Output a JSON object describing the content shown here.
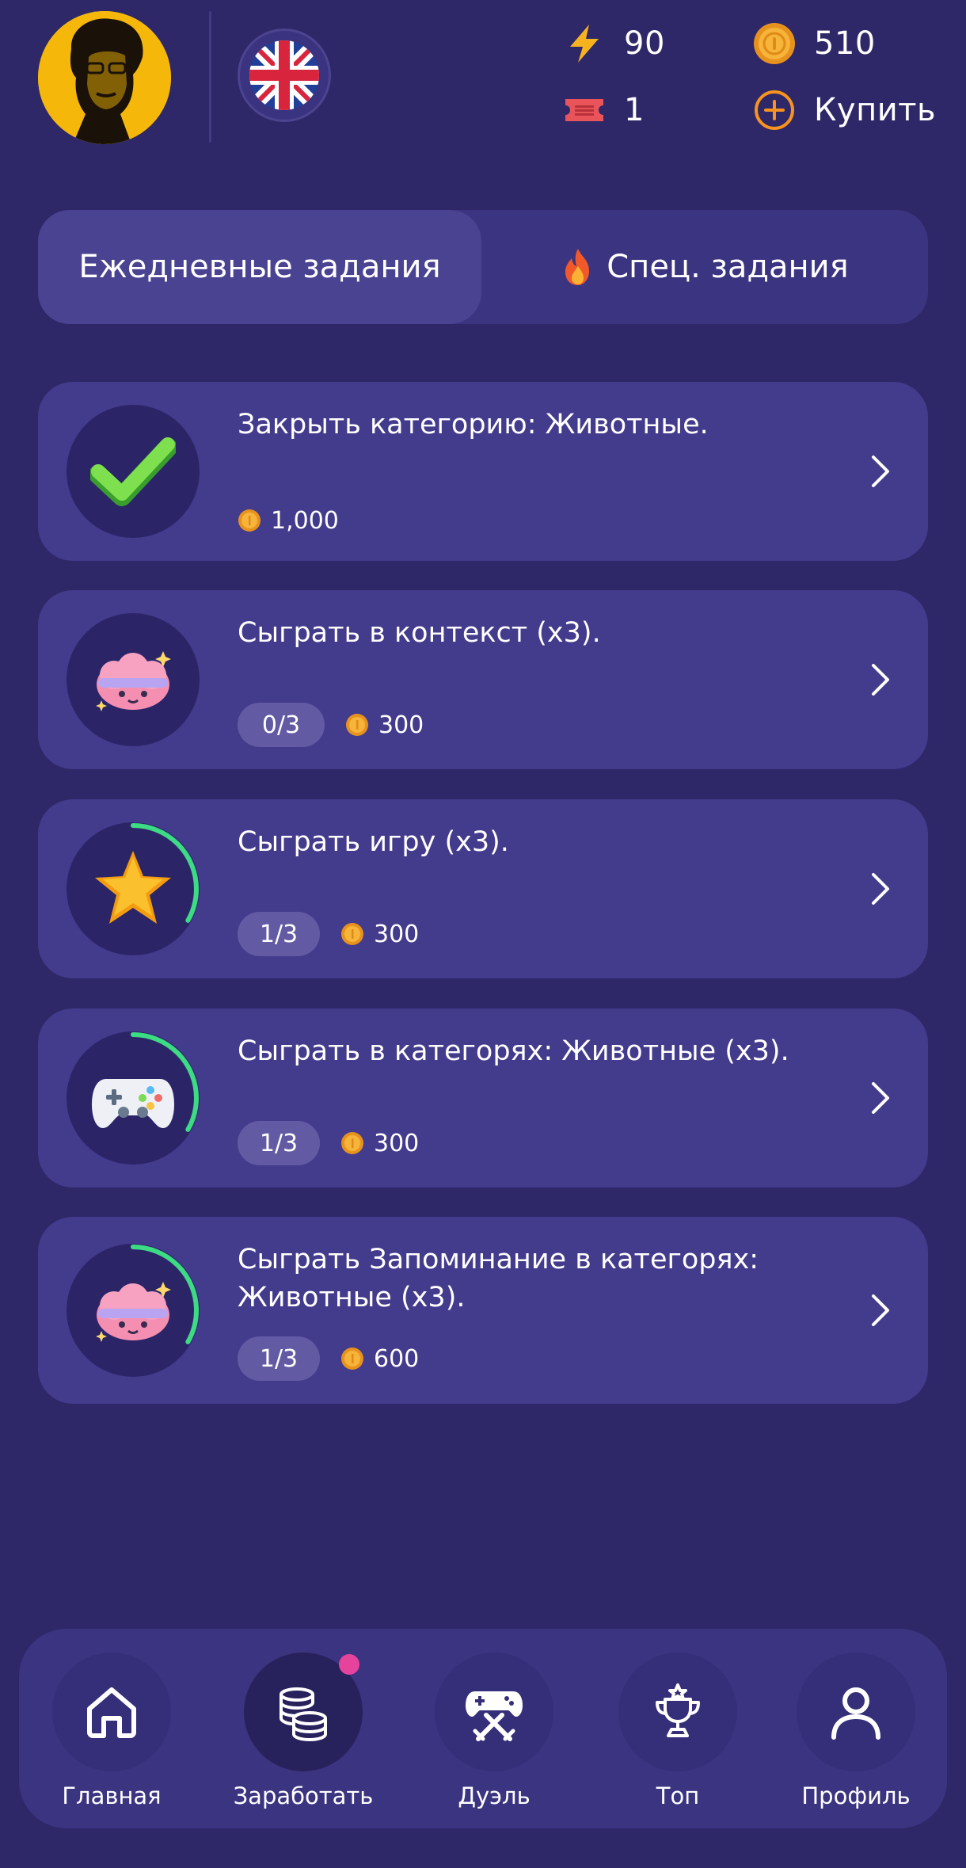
{
  "header": {
    "avatar_icon": "user-avatar",
    "language_flag": "uk-flag-icon",
    "energy": "90",
    "coins": "510",
    "tickets": "1",
    "buy_label": "Купить"
  },
  "tabs": [
    {
      "label": "Ежедневные задания",
      "active": true
    },
    {
      "label": "Спец. задания",
      "icon": "fire-icon",
      "active": false
    }
  ],
  "tasks": [
    {
      "title": "Закрыть категорию: Животные.",
      "progress": null,
      "progress_fraction": 1.0,
      "completed": true,
      "reward": "1,000",
      "icon": "checkmark-icon"
    },
    {
      "title": "Сыграть в контекст (x3).",
      "progress": "0/3",
      "progress_fraction": 0.0,
      "completed": false,
      "reward": "300",
      "icon": "brain-icon"
    },
    {
      "title": "Сыграть игру (x3).",
      "progress": "1/3",
      "progress_fraction": 0.333,
      "completed": false,
      "reward": "300",
      "icon": "star-icon"
    },
    {
      "title": "Сыграть в категорях: Животные (x3).",
      "progress": "1/3",
      "progress_fraction": 0.333,
      "completed": false,
      "reward": "300",
      "icon": "gamepad-icon"
    },
    {
      "title": "Сыграть Запоминание в категорях: Животные (x3).",
      "progress": "1/3",
      "progress_fraction": 0.333,
      "completed": false,
      "reward": "600",
      "icon": "brain-icon"
    }
  ],
  "nav": [
    {
      "label": "Главная",
      "icon": "home-icon",
      "active": false
    },
    {
      "label": "Заработать",
      "icon": "coins-stack-icon",
      "active": true,
      "badge": true
    },
    {
      "label": "Дуэль",
      "icon": "duel-gamepad-icon",
      "active": false
    },
    {
      "label": "Топ",
      "icon": "trophy-icon",
      "active": false
    },
    {
      "label": "Профиль",
      "icon": "profile-icon",
      "active": false
    }
  ],
  "colors": {
    "background": "#2e2868",
    "card": "#433b8c",
    "progress_ring": "#3ddc84",
    "coin": "#f0a52a",
    "accent_orange": "#f7931e",
    "badge": "#e5439c"
  }
}
